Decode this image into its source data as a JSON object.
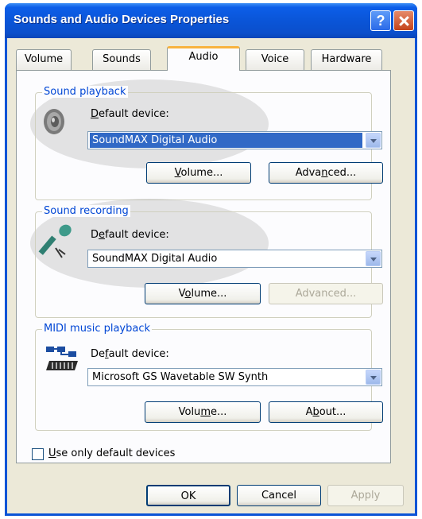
{
  "window": {
    "title": "Sounds and Audio Devices Properties"
  },
  "tabs": [
    {
      "label": "Volume",
      "active": false
    },
    {
      "label": "Sounds",
      "active": false
    },
    {
      "label": "Audio",
      "active": true
    },
    {
      "label": "Voice",
      "active": false
    },
    {
      "label": "Hardware",
      "active": false
    }
  ],
  "sound_playback": {
    "legend": "Sound playback",
    "label_first": "D",
    "label_rest": "efault device:",
    "device": "SoundMAX Digital Audio",
    "volume_first": "V",
    "volume_rest": "olume...",
    "advanced_pre": "Adva",
    "advanced_u": "n",
    "advanced_post": "ced..."
  },
  "sound_recording": {
    "legend": "Sound recording",
    "label_pre": "D",
    "label_u": "e",
    "label_post": "fault device:",
    "device": "SoundMAX Digital Audio",
    "volume_pre": "V",
    "volume_u": "o",
    "volume_post": "lume...",
    "advanced": "Advanced..."
  },
  "midi_playback": {
    "legend": "MIDI music playback",
    "label_pre": "De",
    "label_u": "f",
    "label_post": "ault device:",
    "device": "Microsoft GS Wavetable SW Synth",
    "volume_pre": "Volu",
    "volume_u": "m",
    "volume_post": "e...",
    "about_pre": "A",
    "about_u": "b",
    "about_post": "out..."
  },
  "use_default": {
    "label_first": "U",
    "label_rest": "se only default devices",
    "checked": false
  },
  "footer": {
    "ok": "OK",
    "cancel": "Cancel",
    "apply": "Apply"
  },
  "colors": {
    "title_blue": "#0a54d6",
    "selection": "#3169c6",
    "legend_blue": "#0046d5",
    "tab_highlight": "#f8b33f"
  },
  "icons": [
    "speaker-icon",
    "microphone-icon",
    "midi-keyboard-icon",
    "dropdown-arrow-icon",
    "help-icon",
    "close-icon"
  ]
}
